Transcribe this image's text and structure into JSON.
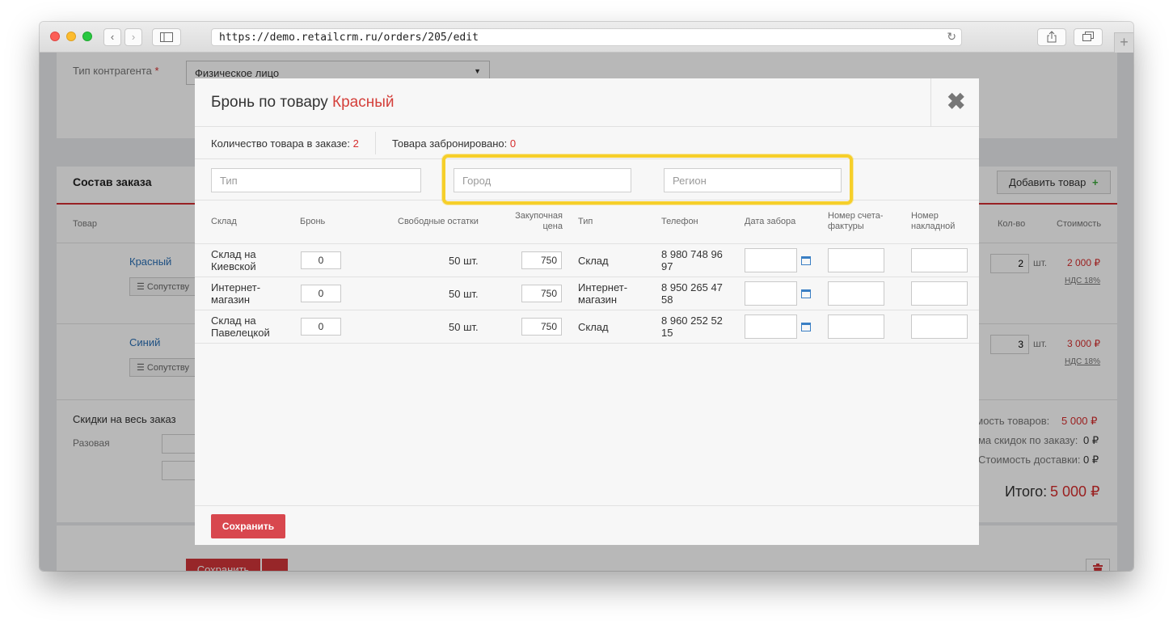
{
  "browser": {
    "url": "https://demo.retailcrm.ru/orders/205/edit",
    "new_tab_label": "+"
  },
  "background": {
    "counterparty_type_label": "Тип контрагента",
    "required_mark": "*",
    "counterparty_type_value": "Физическое лицо",
    "order_section_title": "Состав заказа",
    "add_product_label": "Добавить товар",
    "col_product": "Товар",
    "col_qty": "Кол-во",
    "col_cost": "Стоимость",
    "items": [
      {
        "name": "Красный",
        "qty": "2",
        "unit": "шт.",
        "cost": "2 000 ₽",
        "vat": "НДС 18%",
        "accessory_label": "Сопутству"
      },
      {
        "name": "Синий",
        "qty": "3",
        "unit": "шт.",
        "cost": "3 000 ₽",
        "vat": "НДС 18%",
        "accessory_label": "Сопутству"
      }
    ],
    "discounts_title": "Скидки на весь заказ",
    "one_time_label": "Разовая",
    "summary": {
      "goods_cost_label": "имость товаров:",
      "goods_cost_value": "5 000 ₽",
      "discount_label": "мма скидок по заказу:",
      "discount_value": "0 ₽",
      "delivery_label": "Стоимость доставки:",
      "delivery_value": "0 ₽",
      "total_label": "Итого:",
      "total_value": "5 000 ₽"
    },
    "save_label": "Сохранить"
  },
  "modal": {
    "title": "Бронь по товару",
    "product_name": "Красный",
    "qty_in_order_label": "Количество товара в заказе:",
    "qty_in_order_value": "2",
    "reserved_label": "Товара забронировано:",
    "reserved_value": "0",
    "filters": {
      "type_placeholder": "Тип",
      "city_placeholder": "Город",
      "region_placeholder": "Регион"
    },
    "columns": {
      "warehouse": "Склад",
      "reserve": "Бронь",
      "free_stock": "Свободные остатки",
      "purchase_price_1": "Закупочная",
      "purchase_price_2": "цена",
      "type": "Тип",
      "phone": "Телефон",
      "pickup_date": "Дата забора",
      "invoice_1": "Номер счета-",
      "invoice_2": "фактуры",
      "waybill_1": "Номер",
      "waybill_2": "накладной"
    },
    "rows": [
      {
        "warehouse_1": "Склад на",
        "warehouse_2": "Киевской",
        "reserve": "0",
        "free": "50 шт.",
        "price": "750",
        "type_1": "Склад",
        "type_2": "",
        "phone_1": "8 980 748 96",
        "phone_2": "97"
      },
      {
        "warehouse_1": "Интернет-",
        "warehouse_2": "магазин",
        "reserve": "0",
        "free": "50 шт.",
        "price": "750",
        "type_1": "Интернет-",
        "type_2": "магазин",
        "phone_1": "8 950 265 47",
        "phone_2": "58"
      },
      {
        "warehouse_1": "Склад на",
        "warehouse_2": "Павелецкой",
        "reserve": "0",
        "free": "50 шт.",
        "price": "750",
        "type_1": "Склад",
        "type_2": "",
        "phone_1": "8 960 252 52",
        "phone_2": "15"
      }
    ],
    "save_label": "Сохранить"
  }
}
